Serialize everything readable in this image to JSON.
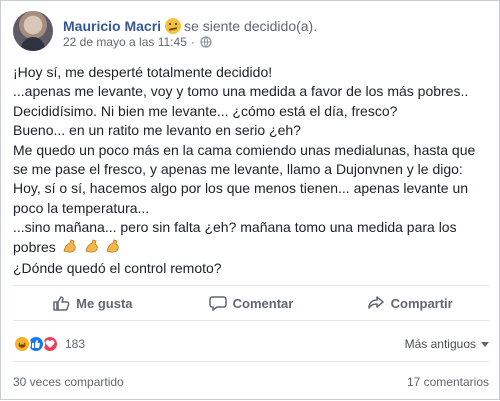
{
  "post": {
    "author": "Mauricio Macri",
    "feeling": "se siente decidido(a).",
    "timestamp": "22 de mayo a las 11:45",
    "separator": "·",
    "lines": [
      "¡Hoy sí, me desperté totalmente decidido!",
      "...apenas me levante, voy y tomo una medida a favor de los más pobres..",
      "Decididísimo. Ni bien me levante... ¿cómo está el día, fresco?",
      "Bueno... en un ratito me levanto en serio ¿eh?",
      "Me quedo un poco más en la cama comiendo unas medialunas, hasta que",
      "se me pase el fresco, y apenas me levante, llamo a Dujonvnen y le digo:",
      "Hoy, sí o sí, hacemos algo por los que menos tienen... apenas levante un",
      "poco la temperatura...",
      "...sino mañana... pero sin falta ¿eh? mañana tomo una medida para los",
      "pobres",
      "¿Dónde quedó el control remoto?"
    ],
    "icons": {
      "feeling": "smug-face-emoji",
      "audience": "globe-icon",
      "flexed_biceps": "flexed-biceps-emoji"
    }
  },
  "actions": {
    "like": "Me gusta",
    "comment": "Comentar",
    "share": "Compartir"
  },
  "reactions": {
    "count": "183",
    "types": [
      "haha",
      "like",
      "love"
    ],
    "sort_label": "Más antiguos"
  },
  "stats": {
    "shares": "30 veces compartido",
    "comments": "17 comentarios"
  },
  "colors": {
    "author_link": "#365899",
    "muted_text": "#616770",
    "like_blue": "#1877f2",
    "love_red": "#f33e58",
    "haha_yellow": "#f7b125"
  }
}
